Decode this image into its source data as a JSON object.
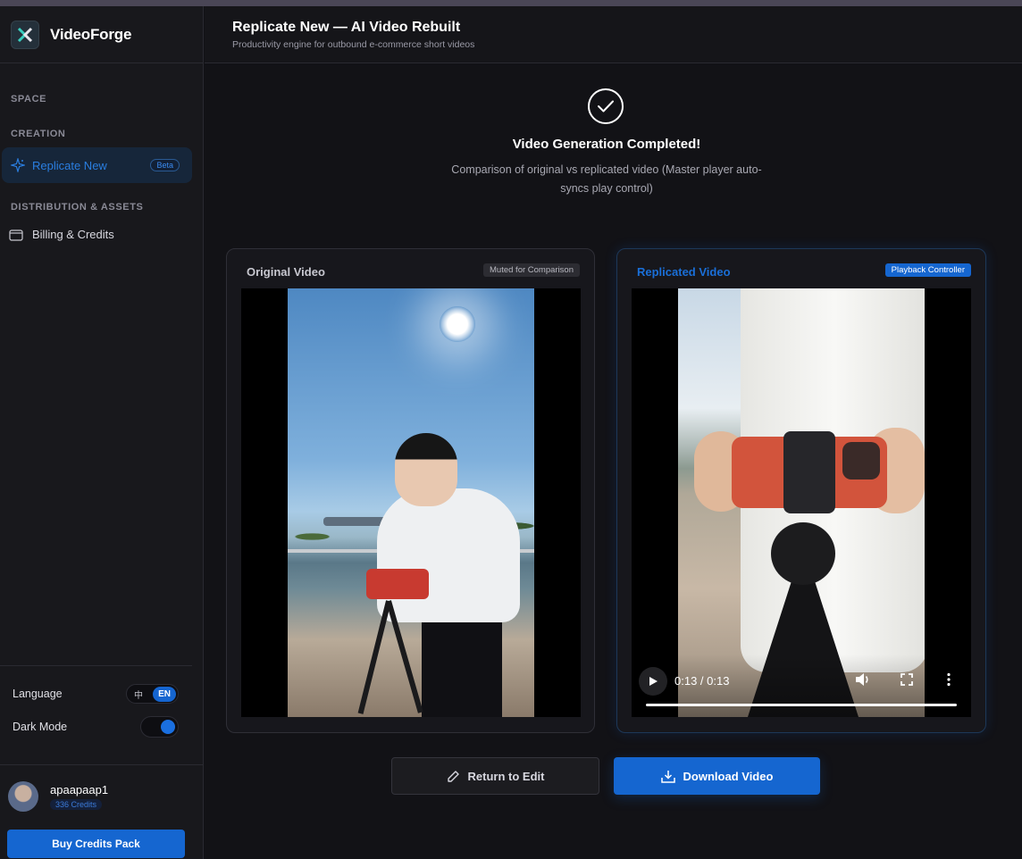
{
  "app": {
    "name": "VideoForge"
  },
  "sidebar": {
    "sections": {
      "space": "SPACE",
      "creation": "CREATION",
      "distribution": "DISTRIBUTION & ASSETS"
    },
    "items": [
      {
        "label": "Replicate New",
        "icon": "sparkle-icon",
        "badge": "Beta",
        "active": true
      },
      {
        "label": "Billing & Credits",
        "icon": "wallet-icon",
        "active": false
      }
    ],
    "settings": {
      "language_label": "Language",
      "language_options": [
        "中",
        "EN"
      ],
      "language_selected": "EN",
      "dark_mode_label": "Dark Mode",
      "dark_mode_on": true
    },
    "user": {
      "name": "apaapaap1",
      "credits": "336 Credits",
      "buy_label": "Buy Credits Pack"
    }
  },
  "header": {
    "title": "Replicate New — AI Video Rebuilt",
    "subtitle": "Productivity engine for outbound e-commerce short videos"
  },
  "status": {
    "icon": "check-circle-icon",
    "title": "Video Generation Completed!",
    "description": "Comparison of original vs replicated video (Master player auto-syncs play control)"
  },
  "videos": {
    "original": {
      "title": "Original Video",
      "badge": "Muted for Comparison"
    },
    "replicated": {
      "title": "Replicated Video",
      "badge": "Playback Controller",
      "player": {
        "time": "0:13 / 0:13",
        "progress": 1.0
      }
    }
  },
  "actions": {
    "return_label": "Return to Edit",
    "download_label": "Download Video"
  },
  "colors": {
    "accent": "#1566d0",
    "background": "#121216",
    "sidebar": "#18181c"
  }
}
